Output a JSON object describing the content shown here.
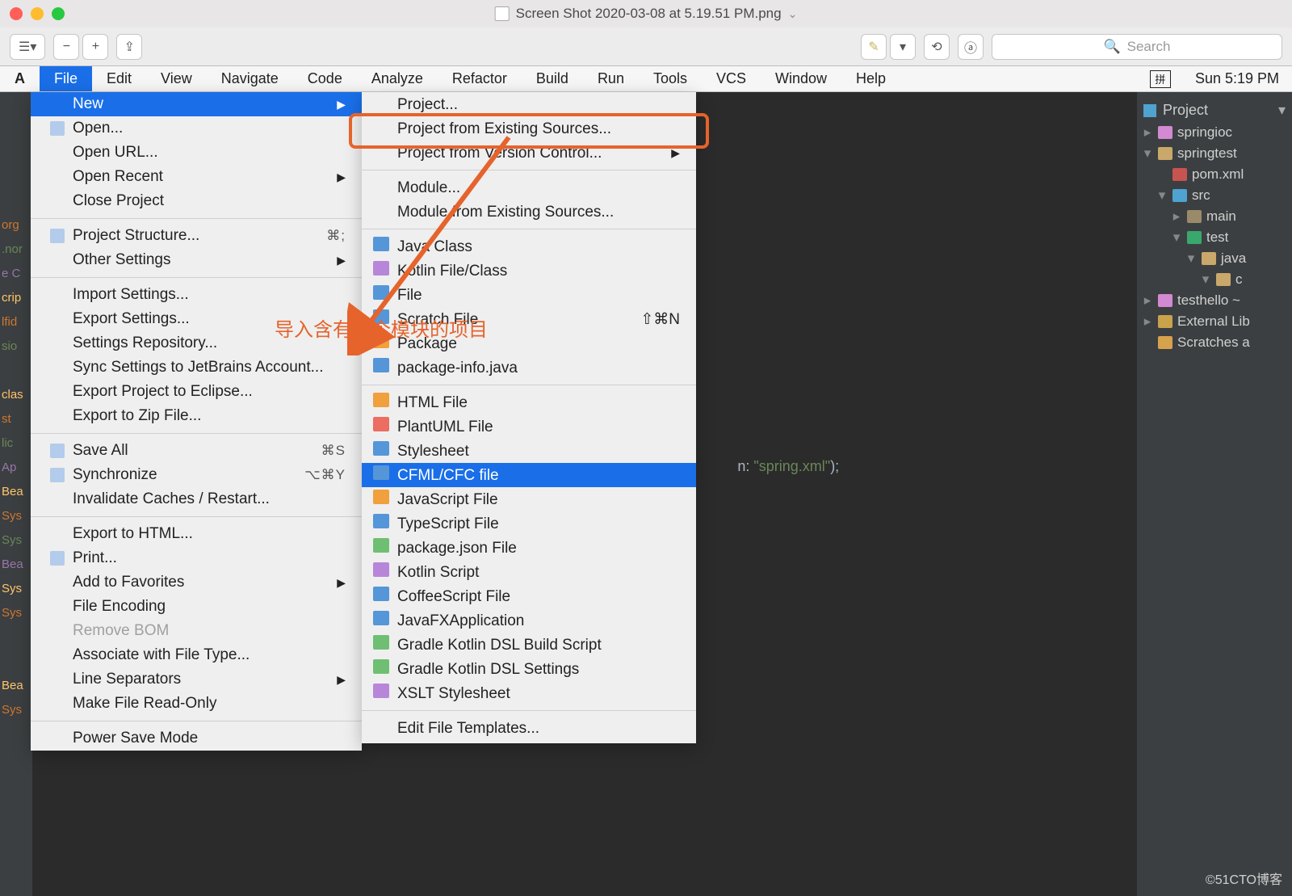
{
  "titlebar": {
    "filename": "Screen Shot 2020-03-08 at 5.19.51 PM.png"
  },
  "toolbar": {
    "search_placeholder": "Search"
  },
  "menubar": {
    "left_stub": "A",
    "items": [
      "File",
      "Edit",
      "View",
      "Navigate",
      "Code",
      "Analyze",
      "Refactor",
      "Build",
      "Run",
      "Tools",
      "VCS",
      "Window",
      "Help"
    ],
    "active": "File",
    "ime": "拼",
    "clock": "Sun 5:19 PM"
  },
  "file_menu": {
    "groups": [
      [
        {
          "label": "New",
          "submenu": true,
          "highlight": true
        },
        {
          "label": "Open...",
          "icon": true
        },
        {
          "label": "Open URL..."
        },
        {
          "label": "Open Recent",
          "submenu": true
        },
        {
          "label": "Close Project"
        }
      ],
      [
        {
          "label": "Project Structure...",
          "icon": true,
          "shortcut": "⌘;"
        },
        {
          "label": "Other Settings",
          "submenu": true
        }
      ],
      [
        {
          "label": "Import Settings..."
        },
        {
          "label": "Export Settings..."
        },
        {
          "label": "Settings Repository..."
        },
        {
          "label": "Sync Settings to JetBrains Account..."
        },
        {
          "label": "Export Project to Eclipse..."
        },
        {
          "label": "Export to Zip File..."
        }
      ],
      [
        {
          "label": "Save All",
          "icon": true,
          "shortcut": "⌘S"
        },
        {
          "label": "Synchronize",
          "icon": true,
          "shortcut": "⌥⌘Y"
        },
        {
          "label": "Invalidate Caches / Restart..."
        }
      ],
      [
        {
          "label": "Export to HTML..."
        },
        {
          "label": "Print...",
          "icon": true
        },
        {
          "label": "Add to Favorites",
          "submenu": true
        },
        {
          "label": "File Encoding"
        },
        {
          "label": "Remove BOM",
          "disabled": true
        },
        {
          "label": "Associate with File Type..."
        },
        {
          "label": "Line Separators",
          "submenu": true
        },
        {
          "label": "Make File Read-Only"
        }
      ],
      [
        {
          "label": "Power Save Mode"
        }
      ]
    ]
  },
  "new_submenu": {
    "groups": [
      [
        {
          "label": "Project..."
        },
        {
          "label": "Project from Existing Sources..."
        },
        {
          "label": "Project from Version Control...",
          "submenu": true
        }
      ],
      [
        {
          "label": "Module..."
        },
        {
          "label": "Module from Existing Sources..."
        }
      ],
      [
        {
          "label": "Java Class",
          "ic": "c1"
        },
        {
          "label": "Kotlin File/Class",
          "ic": "c4"
        },
        {
          "label": "File",
          "ic": "c1"
        },
        {
          "label": "Scratch File",
          "ic": "c1",
          "shortcut": "⇧⌘N"
        },
        {
          "label": "Package",
          "ic": "c2"
        },
        {
          "label": "package-info.java",
          "ic": "c1"
        }
      ],
      [
        {
          "label": "HTML File",
          "ic": "c2"
        },
        {
          "label": "PlantUML File",
          "ic": "c5"
        },
        {
          "label": "Stylesheet",
          "ic": "c1"
        },
        {
          "label": "CFML/CFC file",
          "ic": "c1",
          "sel": true
        },
        {
          "label": "JavaScript File",
          "ic": "c2"
        },
        {
          "label": "TypeScript File",
          "ic": "c1"
        },
        {
          "label": "package.json File",
          "ic": "c3"
        },
        {
          "label": "Kotlin Script",
          "ic": "c4"
        },
        {
          "label": "CoffeeScript File",
          "ic": "c1"
        },
        {
          "label": "JavaFXApplication",
          "ic": "c1"
        },
        {
          "label": "Gradle Kotlin DSL Build Script",
          "ic": "c3"
        },
        {
          "label": "Gradle Kotlin DSL Settings",
          "ic": "c3"
        },
        {
          "label": "XSLT Stylesheet",
          "ic": "c4"
        }
      ],
      [
        {
          "label": "Edit File Templates..."
        }
      ]
    ]
  },
  "annotation": {
    "text": "导入含有整个模块的项目"
  },
  "code": {
    "fragment_pre": "n: ",
    "fragment_str": "\"spring.xml\"",
    "fragment_post": ");"
  },
  "project": {
    "header": "Project",
    "tree": [
      {
        "ind": 0,
        "tog": ">",
        "ic": "mod",
        "label": "springioc",
        "color": "#d28ad2"
      },
      {
        "ind": 0,
        "tog": "v",
        "ic": "fold",
        "label": "springtest",
        "color": "#c9a86b"
      },
      {
        "ind": 1,
        "tog": "",
        "ic": "xml",
        "label": "pom.xml",
        "color": "#c75450",
        "text": "V"
      },
      {
        "ind": 1,
        "tog": "v",
        "ic": "foldb",
        "label": "src",
        "color": "#4fa3d1"
      },
      {
        "ind": 2,
        "tog": ">",
        "ic": "fold",
        "label": "main",
        "color": "#9b8a6a"
      },
      {
        "ind": 2,
        "tog": "v",
        "ic": "foldb",
        "label": "test",
        "color": "#3aa76d"
      },
      {
        "ind": 3,
        "tog": "v",
        "ic": "fold",
        "label": "java",
        "color": "#c9a86b"
      },
      {
        "ind": 4,
        "tog": "v",
        "ic": "fold",
        "label": "c",
        "color": "#c9a86b"
      },
      {
        "ind": 0,
        "tog": ">",
        "ic": "mod",
        "label": "testhello  ~",
        "color": "#d28ad2"
      },
      {
        "ind": 0,
        "tog": ">",
        "ic": "lib",
        "label": "External Lib",
        "color": "#c9a24c"
      },
      {
        "ind": 0,
        "tog": "",
        "ic": "scr",
        "label": "Scratches a",
        "color": "#d6a24c"
      }
    ]
  },
  "gutter": [
    "org",
    ".nor",
    "e C",
    "crip",
    "lfid",
    "sio",
    "",
    "clas",
    "st",
    "lic",
    "Ap",
    "Bea",
    "Sys",
    "Sys",
    "Bea",
    "Sys",
    "Sys",
    "",
    "",
    "Bea",
    "Sys"
  ],
  "watermark": "©51CTO博客"
}
